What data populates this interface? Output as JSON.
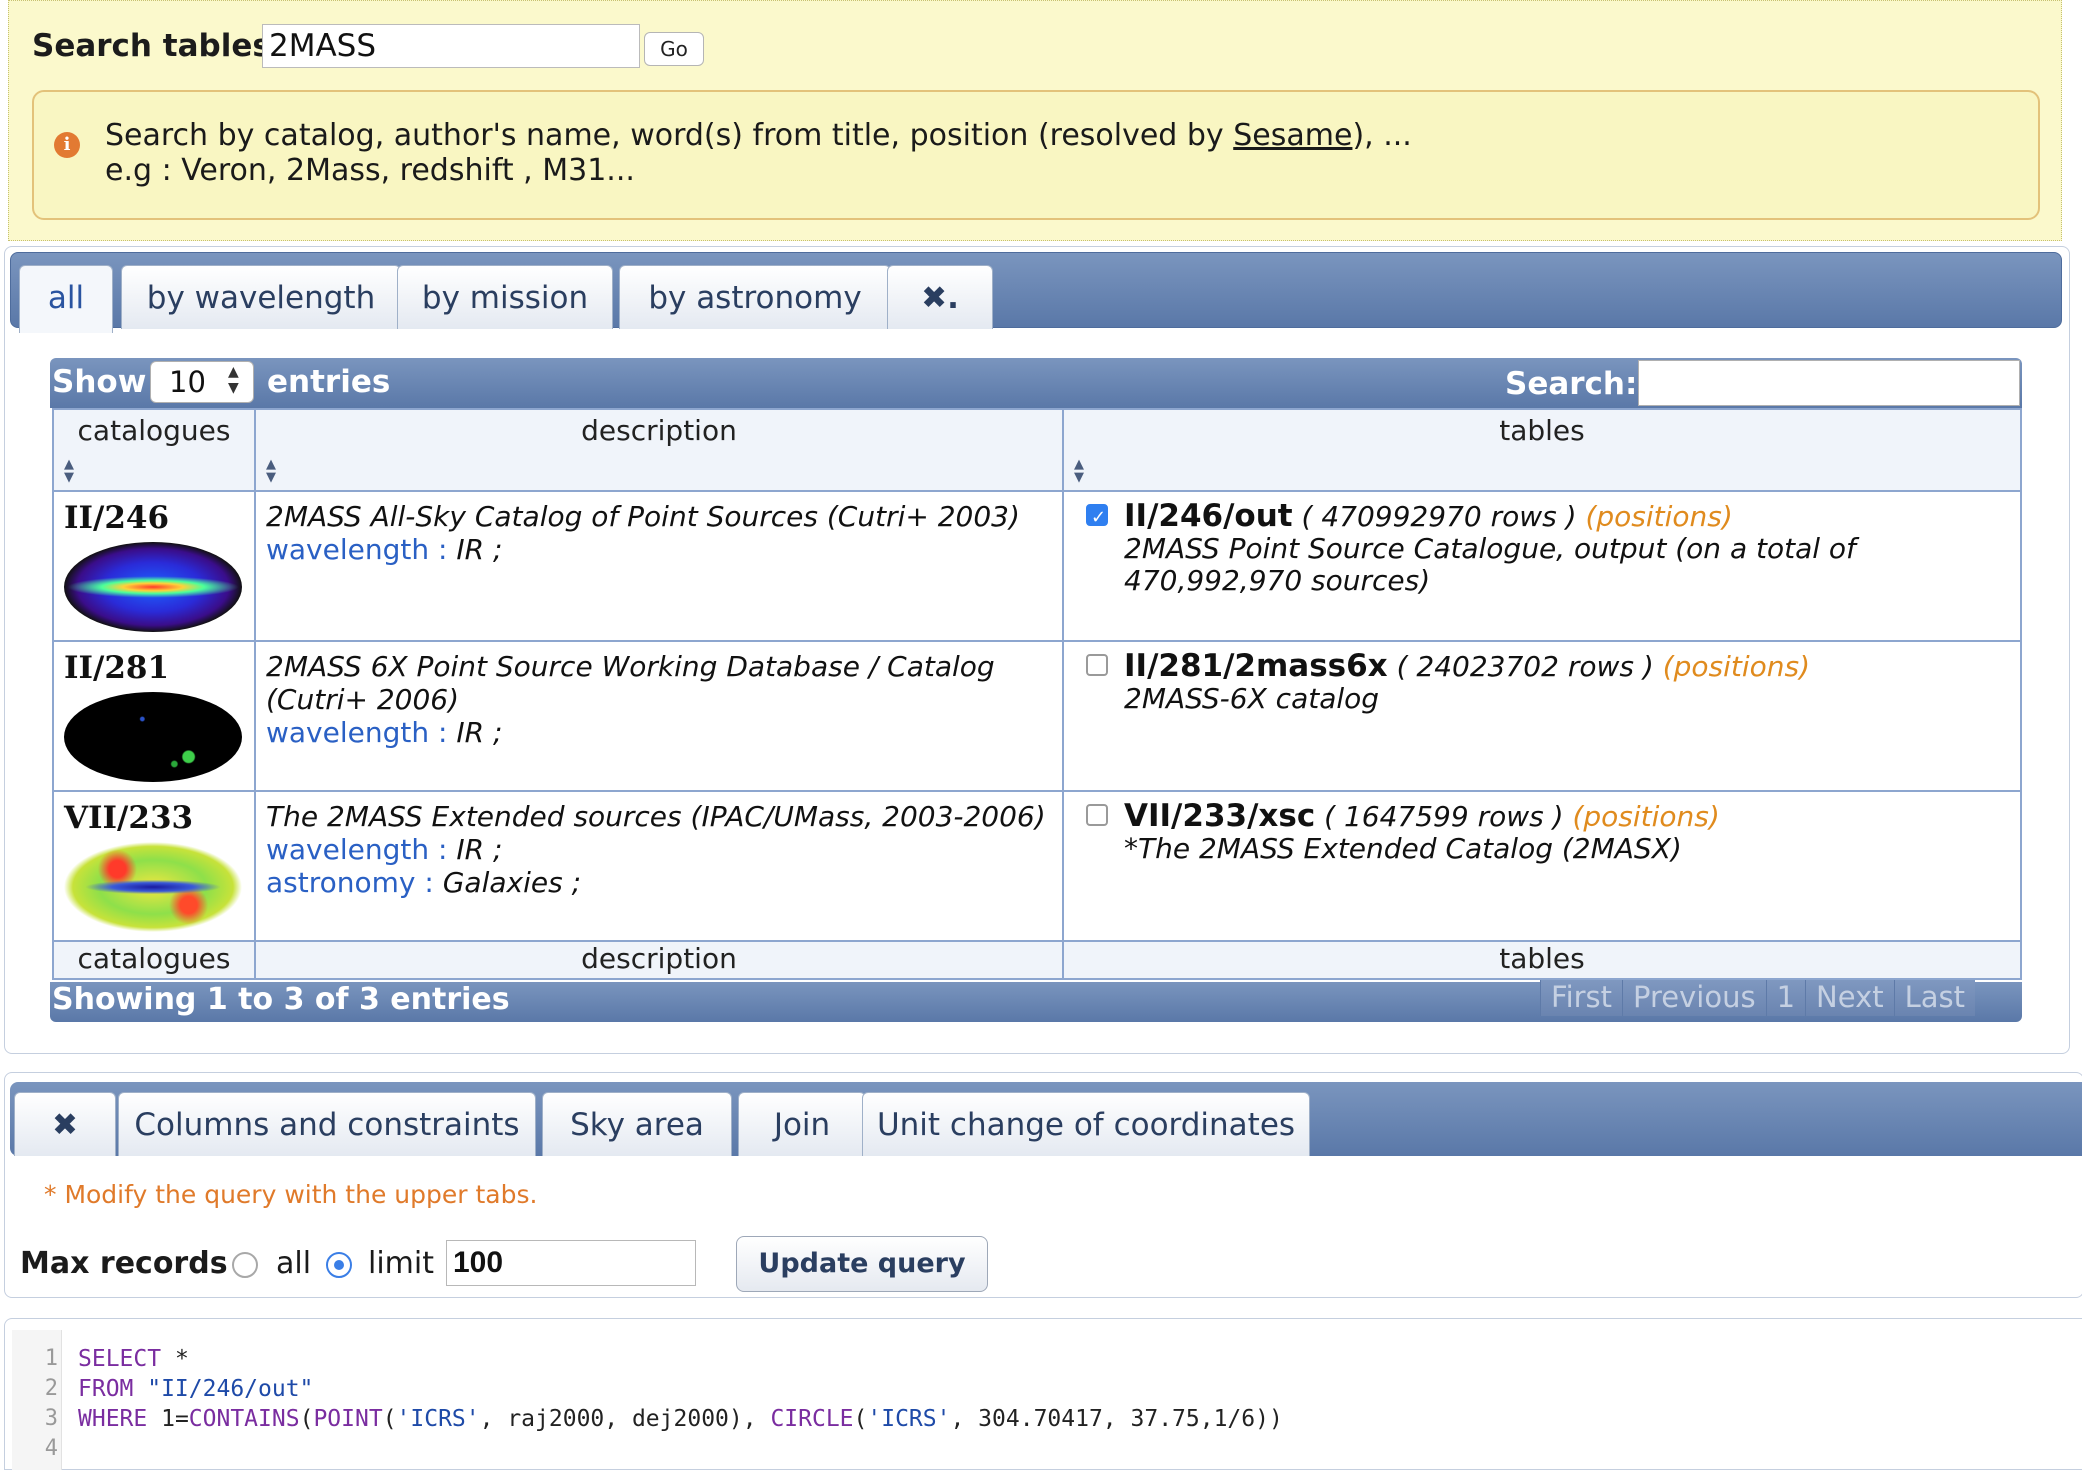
{
  "search": {
    "label": "Search tables",
    "value": "2MASS",
    "go_label": "Go",
    "info_line1_prefix": "Search by catalog, author's name, word(s) from title, position (resolved by ",
    "info_link": "Sesame",
    "info_line1_suffix": "), ...",
    "info_line2": "e.g : Veron, 2Mass, redshift , M31..."
  },
  "filter_tabs": [
    {
      "label": "all",
      "active": true
    },
    {
      "label": "by wavelength"
    },
    {
      "label": "by mission"
    },
    {
      "label": "by astronomy"
    },
    {
      "label": "✖."
    }
  ],
  "datatable": {
    "show_label": "Show",
    "page_length": "10",
    "entries_label": "entries",
    "search_label": "Search:",
    "search_value": "",
    "columns": [
      "catalogues",
      "description",
      "tables"
    ],
    "rows": [
      {
        "catalog": "II/246",
        "map": "ir-allsky",
        "title": "2MASS All-Sky Catalog of Point Sources (Cutri+ 2003)",
        "keywords": [
          {
            "key": "wavelength",
            "sep": " : ",
            "value": "IR ;"
          }
        ],
        "table_checked": true,
        "table_name": "II/246/out",
        "table_rows": "( 470992970 rows )",
        "positions": "(positions)",
        "table_desc": "2MASS Point Source Catalogue, output (on a total of 470,992,970 sources)"
      },
      {
        "catalog": "II/281",
        "map": "dark-sky",
        "title": "2MASS 6X Point Source Working Database / Catalog (Cutri+ 2006)",
        "keywords": [
          {
            "key": "wavelength",
            "sep": " : ",
            "value": "IR ;"
          }
        ],
        "table_checked": false,
        "table_name": "II/281/2mass6x",
        "table_rows": "( 24023702 rows )",
        "positions": "(positions)",
        "table_desc": "2MASS-6X catalog"
      },
      {
        "catalog": "VII/233",
        "map": "galaxy-sky",
        "title": "The 2MASS Extended sources (IPAC/UMass, 2003-2006)",
        "keywords": [
          {
            "key": "wavelength",
            "sep": " : ",
            "value": "IR ;"
          },
          {
            "key": "astronomy",
            "sep": " : ",
            "value": "Galaxies ;"
          }
        ],
        "table_checked": false,
        "table_name": "VII/233/xsc",
        "table_rows": "( 1647599 rows )",
        "positions": "(positions)",
        "table_desc": "*The 2MASS Extended Catalog (2MASX)"
      }
    ],
    "info": "Showing 1 to 3 of 3 entries",
    "pagination": [
      "First",
      "Previous",
      "1",
      "Next",
      "Last"
    ]
  },
  "query_tabs": [
    {
      "label": "✖"
    },
    {
      "label": "Columns and constraints"
    },
    {
      "label": "Sky area"
    },
    {
      "label": "Join"
    },
    {
      "label": "Unit change of coordinates"
    }
  ],
  "query": {
    "note": "* Modify the query with the upper tabs.",
    "max_records_label": "Max records",
    "radio_all": "all",
    "radio_limit": "limit",
    "selected": "limit",
    "limit_value": "100",
    "update_label": "Update query"
  },
  "editor": {
    "line_numbers": [
      "1",
      "2",
      "3",
      "4"
    ],
    "line1_kw": "SELECT",
    "line1_rest": " *",
    "line2_kw": "FROM",
    "line2_str": " \"II/246/out\"",
    "line3": [
      {
        "t": "WHERE",
        "c": "kw"
      },
      {
        "t": " 1=",
        "c": ""
      },
      {
        "t": "CONTAINS",
        "c": "kw"
      },
      {
        "t": "(",
        "c": ""
      },
      {
        "t": "POINT",
        "c": "kw"
      },
      {
        "t": "(",
        "c": ""
      },
      {
        "t": "'ICRS'",
        "c": "str"
      },
      {
        "t": ", raj2000, dej2000), ",
        "c": ""
      },
      {
        "t": "CIRCLE",
        "c": "kw"
      },
      {
        "t": "(",
        "c": ""
      },
      {
        "t": "'ICRS'",
        "c": "str"
      },
      {
        "t": ", 304.70417, 37.75,1/6))",
        "c": ""
      }
    ]
  }
}
